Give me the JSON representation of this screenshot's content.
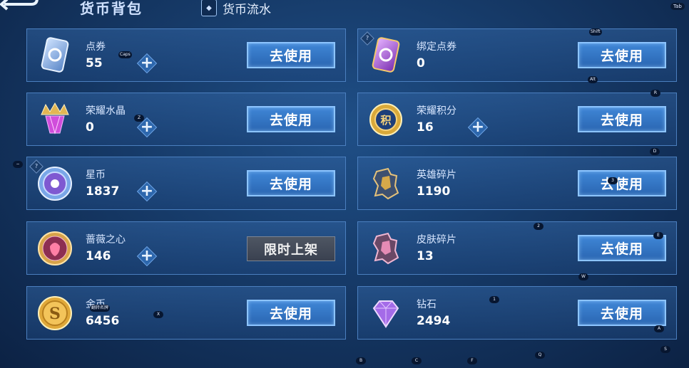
{
  "header": {
    "title": "货币背包",
    "flow_label": "货币流水",
    "tab_key": "Tab"
  },
  "actions": {
    "use_label": "去使用",
    "limited_label": "限时上架",
    "plus_label": "+"
  },
  "currencies": [
    {
      "name": "点券",
      "amount": "55",
      "icon": "voucher-card-icon"
    },
    {
      "name": "绑定点券",
      "amount": "0",
      "icon": "bound-voucher-card-icon"
    },
    {
      "name": "荣耀水晶",
      "amount": "0",
      "icon": "glory-crystal-icon"
    },
    {
      "name": "荣耀积分",
      "amount": "16",
      "icon": "glory-points-coin-icon",
      "coin_text": "积"
    },
    {
      "name": "星币",
      "amount": "1837",
      "icon": "star-coin-icon"
    },
    {
      "name": "英雄碎片",
      "amount": "1190",
      "icon": "hero-fragment-icon"
    },
    {
      "name": "蔷薇之心",
      "amount": "146",
      "icon": "rose-heart-icon"
    },
    {
      "name": "皮肤碎片",
      "amount": "13",
      "icon": "skin-fragment-icon"
    },
    {
      "name": "金币",
      "amount": "6456",
      "icon": "gold-coin-icon",
      "coin_text": "S"
    },
    {
      "name": "钻石",
      "amount": "2494",
      "icon": "diamond-icon"
    }
  ],
  "key_hints": {
    "caps": "Caps",
    "shift": "Shift",
    "alt": "Alt",
    "r": "R",
    "z": "Z",
    "d": "D",
    "minus": "−",
    "three": "3",
    "two": "2",
    "e": "E",
    "w": "W",
    "one": "1",
    "x": "X",
    "a": "A",
    "s": "S",
    "b": "B",
    "c": "C",
    "f": "F",
    "q": "Q",
    "gold_overlay": "翻转名牌"
  },
  "colors": {
    "use_button": "#3f86d6",
    "limited_button": "#4e5663",
    "card_border": "#4b7fbf"
  }
}
